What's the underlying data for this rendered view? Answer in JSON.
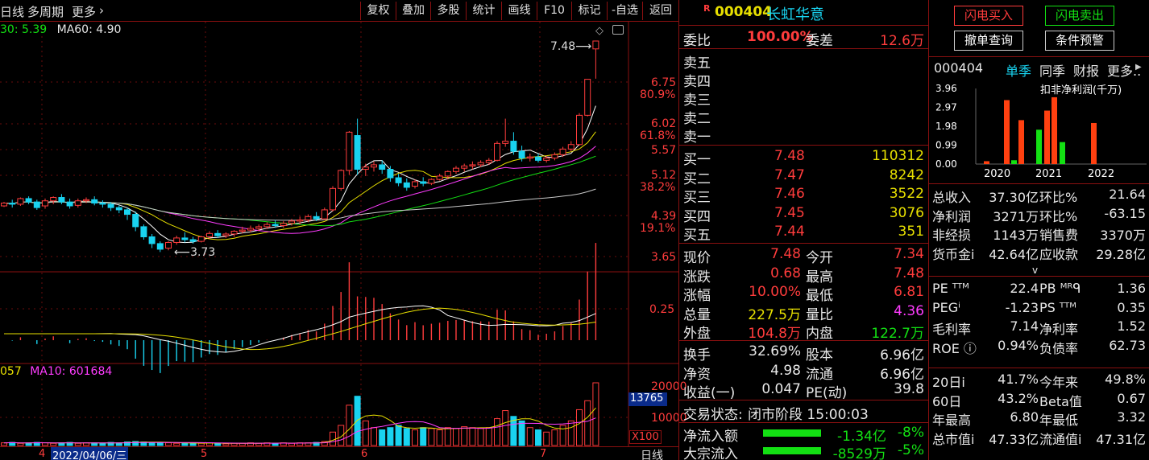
{
  "toolbar": {
    "period": "日线",
    "multi_period": "多周期",
    "more": "更多",
    "more_chevron": "›",
    "buttons": [
      "复权",
      "叠加",
      "多股",
      "统计",
      "画线",
      "F10",
      "标记",
      "-自选",
      "返回"
    ]
  },
  "indicators": {
    "ma_partial": "30: 5.39",
    "ma60": "MA60: 4.90",
    "vol_partial": "057",
    "ma10": "MA10: 601684"
  },
  "chart_data": {
    "type": "candlestick",
    "price_axis_labels": [
      "6.75",
      "80.9%",
      "6.02",
      "61.8%",
      "5.57",
      "5.12",
      "38.2%",
      "4.39",
      "19.1%",
      "3.65"
    ],
    "high_annotation": "7.48",
    "low_annotation": "3.73",
    "macd_axis_label": "0.25",
    "volume_axis_labels": [
      "20000",
      "13765",
      "10000",
      "X100"
    ],
    "x_labels": [
      "4",
      "2022/04/06/三",
      "5",
      "6",
      "7"
    ],
    "period_label": "日线",
    "candles": [
      [
        4.55,
        4.62,
        4.6,
        4.53
      ],
      [
        4.6,
        4.66,
        4.58,
        4.52
      ],
      [
        4.58,
        4.7,
        4.68,
        4.55
      ],
      [
        4.68,
        4.72,
        4.62,
        4.58
      ],
      [
        4.62,
        4.66,
        4.52,
        4.48
      ],
      [
        4.55,
        4.68,
        4.64,
        4.5
      ],
      [
        4.64,
        4.72,
        4.7,
        4.58
      ],
      [
        4.7,
        4.76,
        4.62,
        4.58
      ],
      [
        4.62,
        4.68,
        4.55,
        4.5
      ],
      [
        4.56,
        4.68,
        4.64,
        4.52
      ],
      [
        4.64,
        4.7,
        4.66,
        4.6
      ],
      [
        4.66,
        4.72,
        4.6,
        4.56
      ],
      [
        4.6,
        4.65,
        4.58,
        4.52
      ],
      [
        4.58,
        4.62,
        4.52,
        4.46
      ],
      [
        4.52,
        4.56,
        4.48,
        4.42
      ],
      [
        4.48,
        4.52,
        4.4,
        4.3
      ],
      [
        4.4,
        4.45,
        4.18,
        4.1
      ],
      [
        4.18,
        4.22,
        4.0,
        3.95
      ],
      [
        4.0,
        4.05,
        3.88,
        3.8
      ],
      [
        3.88,
        3.92,
        3.78,
        3.73
      ],
      [
        3.8,
        3.92,
        3.9,
        3.76
      ],
      [
        3.9,
        4.02,
        3.98,
        3.86
      ],
      [
        3.98,
        4.08,
        3.95,
        3.9
      ],
      [
        3.95,
        4.0,
        3.92,
        3.88
      ],
      [
        3.92,
        4.02,
        4.0,
        3.9
      ],
      [
        4.0,
        4.1,
        4.06,
        3.96
      ],
      [
        4.06,
        4.12,
        4.02,
        3.98
      ],
      [
        4.02,
        4.08,
        4.05,
        3.98
      ],
      [
        4.05,
        4.12,
        4.1,
        4.0
      ],
      [
        4.1,
        4.18,
        4.12,
        4.06
      ],
      [
        4.12,
        4.2,
        4.15,
        4.08
      ],
      [
        4.15,
        4.22,
        4.18,
        4.1
      ],
      [
        4.18,
        4.26,
        4.22,
        4.14
      ],
      [
        4.22,
        4.3,
        4.2,
        4.16
      ],
      [
        4.2,
        4.28,
        4.24,
        4.16
      ],
      [
        4.24,
        4.32,
        4.28,
        4.2
      ],
      [
        4.28,
        4.36,
        4.3,
        4.22
      ],
      [
        4.3,
        4.4,
        4.36,
        4.26
      ],
      [
        4.36,
        4.44,
        4.32,
        4.28
      ],
      [
        4.32,
        4.52,
        4.48,
        4.3
      ],
      [
        4.48,
        4.9,
        4.86,
        4.45
      ],
      [
        4.86,
        5.2,
        5.18,
        4.82
      ],
      [
        5.18,
        5.88,
        5.86,
        5.1
      ],
      [
        5.8,
        6.1,
        5.2,
        5.1
      ],
      [
        5.2,
        5.3,
        5.24,
        5.08
      ],
      [
        5.24,
        5.34,
        5.28,
        5.16
      ],
      [
        5.28,
        5.36,
        5.2,
        5.12
      ],
      [
        5.2,
        5.26,
        5.05,
        4.98
      ],
      [
        5.05,
        5.12,
        4.96,
        4.9
      ],
      [
        4.96,
        5.04,
        4.88,
        4.82
      ],
      [
        4.9,
        5.02,
        4.98,
        4.86
      ],
      [
        4.98,
        5.06,
        4.95,
        4.9
      ],
      [
        4.95,
        5.04,
        5.02,
        4.92
      ],
      [
        5.02,
        5.12,
        5.08,
        5.0
      ],
      [
        5.08,
        5.18,
        5.16,
        5.02
      ],
      [
        5.16,
        5.26,
        5.22,
        5.12
      ],
      [
        5.22,
        5.3,
        5.26,
        5.16
      ],
      [
        5.26,
        5.34,
        5.28,
        5.2
      ],
      [
        5.28,
        5.36,
        5.32,
        5.24
      ],
      [
        5.32,
        5.4,
        5.36,
        5.28
      ],
      [
        5.36,
        5.7,
        5.66,
        5.34
      ],
      [
        5.66,
        6.1,
        5.7,
        5.6
      ],
      [
        5.7,
        5.86,
        5.52,
        5.46
      ],
      [
        5.52,
        5.62,
        5.4,
        5.34
      ],
      [
        5.4,
        5.48,
        5.42,
        5.34
      ],
      [
        5.42,
        5.48,
        5.36,
        5.32
      ],
      [
        5.36,
        5.44,
        5.4,
        5.32
      ],
      [
        5.4,
        5.5,
        5.46,
        5.36
      ],
      [
        5.46,
        5.6,
        5.56,
        5.42
      ],
      [
        5.56,
        5.7,
        5.64,
        5.52
      ],
      [
        5.64,
        6.2,
        6.16,
        5.62
      ],
      [
        6.16,
        6.8,
        6.8,
        6.14
      ],
      [
        7.34,
        7.48,
        7.48,
        6.81
      ]
    ],
    "volumes": [
      6,
      7,
      5,
      6,
      7,
      6,
      5,
      6,
      7,
      5,
      6,
      6,
      5,
      7,
      6,
      8,
      9,
      8,
      7,
      6,
      6,
      5,
      6,
      5,
      5,
      6,
      5,
      4,
      5,
      5,
      6,
      5,
      6,
      5,
      6,
      5,
      6,
      6,
      7,
      9,
      30,
      45,
      90,
      110,
      55,
      40,
      35,
      40,
      45,
      38,
      35,
      40,
      38,
      35,
      40,
      38,
      42,
      40,
      38,
      40,
      60,
      78,
      65,
      55,
      40,
      35,
      30,
      35,
      45,
      55,
      80,
      100,
      140
    ]
  },
  "quote": {
    "mark": "R",
    "code": "000404",
    "name": "长虹华意",
    "webi_label": "委比",
    "webi_value": "100.00%",
    "weicha_label": "委差",
    "weicha_value": "12.6万",
    "asks": [
      "卖五",
      "卖四",
      "卖三",
      "卖二",
      "卖一"
    ],
    "bids": [
      {
        "label": "买一",
        "price": "7.48",
        "vol": "110312"
      },
      {
        "label": "买二",
        "price": "7.47",
        "vol": "8242"
      },
      {
        "label": "买三",
        "price": "7.46",
        "vol": "3522"
      },
      {
        "label": "买四",
        "price": "7.45",
        "vol": "3076"
      },
      {
        "label": "买五",
        "price": "7.44",
        "vol": "351"
      }
    ],
    "stats1": [
      {
        "l1": "现价",
        "v1": "7.48",
        "c1": "red",
        "l2": "今开",
        "v2": "7.34",
        "c2": "red"
      },
      {
        "l1": "涨跌",
        "v1": "0.68",
        "c1": "red",
        "l2": "最高",
        "v2": "7.48",
        "c2": "red"
      },
      {
        "l1": "涨幅",
        "v1": "10.00%",
        "c1": "red",
        "l2": "最低",
        "v2": "6.81",
        "c2": "red"
      },
      {
        "l1": "总量",
        "v1": "227.5万",
        "c1": "yellow",
        "l2": "量比",
        "v2": "4.36",
        "c2": "magenta"
      },
      {
        "l1": "外盘",
        "v1": "104.8万",
        "c1": "red",
        "l2": "内盘",
        "v2": "122.7万",
        "c2": "green"
      }
    ],
    "stats2": [
      {
        "l1": "换手",
        "v1": "32.69%",
        "l2": "股本",
        "v2": "6.96亿"
      },
      {
        "l1": "净资",
        "v1": "4.98",
        "l2": "流通",
        "v2": "6.96亿"
      },
      {
        "l1": "收益(一)",
        "v1": "0.047",
        "l2": "PE(动)",
        "v2": "39.8"
      }
    ],
    "trade_status_label": "交易状态:",
    "trade_status_value": "闭市阶段 15:00:03",
    "flows": [
      {
        "label": "净流入额",
        "value": "-1.34亿",
        "pct": "-8%"
      },
      {
        "label": "大宗流入",
        "value": "-8529万",
        "pct": "-5%"
      }
    ]
  },
  "info": {
    "flash_buy": "闪电买入",
    "flash_sell": "闪电卖出",
    "cancel_query": "撤单查询",
    "condition_alert": "条件预警",
    "tab_code": "000404",
    "tabs": [
      "单季",
      "同季",
      "财报",
      "更多.."
    ],
    "mini_chart": {
      "title": "扣非净利润(千万)",
      "y_labels": [
        "3.96",
        "2.97",
        "1.98",
        "0.99",
        "0.00"
      ],
      "x_labels": [
        "2020",
        "2021",
        "2022"
      ],
      "bars": [
        {
          "value": 0.15,
          "color": "#ff4010"
        },
        {
          "value": 3.35,
          "color": "#ff4010"
        },
        {
          "value": 0.2,
          "color": "#13e013"
        },
        {
          "value": 2.3,
          "color": "#ff4010"
        },
        {
          "value": 1.8,
          "color": "#13e013"
        },
        {
          "value": 2.8,
          "color": "#ff4010"
        },
        {
          "value": 3.5,
          "color": "#ff4010"
        },
        {
          "value": 1.15,
          "color": "#13e013"
        },
        {
          "value": 2.15,
          "color": "#ff4010"
        }
      ]
    },
    "fin1": [
      {
        "l1": "总收入",
        "v1": "37.30亿",
        "l2": "环比%",
        "v2": "21.64"
      },
      {
        "l1": "净利润",
        "v1": "3271万",
        "l2": "环比%",
        "v2": "-63.15"
      },
      {
        "l1": "非经损",
        "v1": "1143万",
        "l2": "销售费",
        "v2": "3370万"
      },
      {
        "l1": "货币金i",
        "v1": "42.64亿",
        "l2": "应收款",
        "v2": "29.28亿"
      }
    ],
    "expand": "v",
    "fin2": [
      {
        "l1": "PE ᵀᵀᴹ",
        "v1": "22.4",
        "l2": "PB ᴹᴿᑫ",
        "v2": "1.36"
      },
      {
        "l1": "PEGⁱ",
        "v1": "-1.23",
        "l2": "PS ᵀᵀᴹ",
        "v2": "0.35"
      },
      {
        "l1": "毛利率",
        "v1": "7.14",
        "l2": "净利率",
        "v2": "1.52"
      },
      {
        "l1": "ROE ⓘ",
        "v1": "0.94%",
        "l2": "负债率",
        "v2": "62.73"
      }
    ],
    "fin3": [
      {
        "l1": "20日i",
        "v1": "41.7%",
        "l2": "今年来",
        "v2": "49.8%"
      },
      {
        "l1": "60日",
        "v1": "43.2%",
        "l2": "Beta值",
        "v2": "0.67"
      },
      {
        "l1": "年最高",
        "v1": "6.80",
        "l2": "年最低",
        "v2": "3.32"
      },
      {
        "l1": "总市值i",
        "v1": "47.33亿",
        "l2": "流通值i",
        "v2": "47.31亿"
      }
    ]
  }
}
